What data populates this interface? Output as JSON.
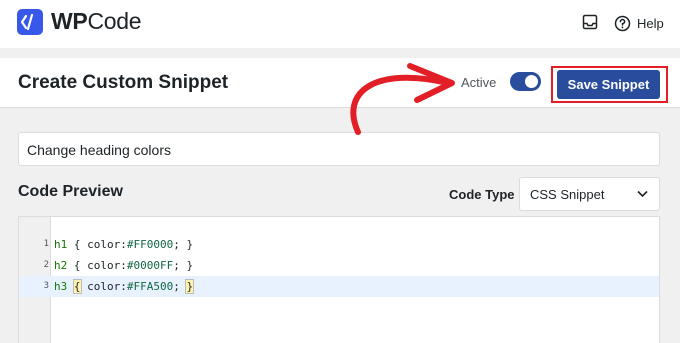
{
  "app": {
    "logo_left": "WP",
    "logo_right": "Code"
  },
  "topbar": {
    "help_label": "Help"
  },
  "header": {
    "title": "Create Custom Snippet",
    "active_label": "Active",
    "active": true,
    "save_label": "Save Snippet"
  },
  "snippet": {
    "name": "Change heading colors"
  },
  "preview": {
    "label": "Code Preview",
    "code_type_label": "Code Type",
    "code_type_value": "CSS Snippet"
  },
  "code_lines": [
    {
      "num": "1",
      "selector": "h1",
      "open": " { ",
      "prop": "color:",
      "value": "#FF0000",
      "close": "; }"
    },
    {
      "num": "2",
      "selector": "h2",
      "open": " { ",
      "prop": "color:",
      "value": "#0000FF",
      "close": "; }"
    },
    {
      "num": "3",
      "selector": "h3",
      "open": " ",
      "brace_open": "{",
      "mid": " ",
      "prop": "color:",
      "value": "#FFA500",
      "close": "; ",
      "brace_close": "}"
    }
  ],
  "colors": {
    "brand": "#3858e9",
    "button": "#2a4c9c",
    "highlight": "#e21f26"
  },
  "icons": [
    "wpcode-logo-icon",
    "inbox-icon",
    "help-circle-icon",
    "chevron-down-icon",
    "red-arrow-annotation"
  ]
}
